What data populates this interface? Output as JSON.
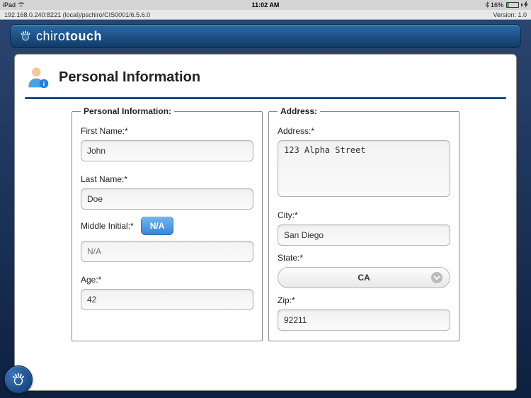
{
  "status": {
    "device": "iPad",
    "wifi": true,
    "time": "11:02 AM",
    "bluetooth": true,
    "battery_pct": "16%",
    "charging": true
  },
  "url_bar": {
    "text": "192.168.0.240:8221 (local)/pschiro/CIS0001/6.5.6.0",
    "version": "Version: 1.0"
  },
  "brand": {
    "name_prefix": "chiro",
    "name_suffix": "touch"
  },
  "page": {
    "title": "Personal Information"
  },
  "personal": {
    "legend": "Personal Information:",
    "first_name_label": "First Name:*",
    "first_name": "John",
    "last_name_label": "Last Name:*",
    "last_name": "Doe",
    "mi_label": "Middle Initial:*",
    "na_button": "N/A",
    "mi_placeholder": "N/A",
    "mi_value": "",
    "age_label": "Age:*",
    "age": "42"
  },
  "address": {
    "legend": "Address:",
    "address_label": "Address:*",
    "address": "123 Alpha Street",
    "city_label": "City:*",
    "city": "San Diego",
    "state_label": "State:*",
    "state": "CA",
    "zip_label": "Zip:*",
    "zip": "92211"
  }
}
